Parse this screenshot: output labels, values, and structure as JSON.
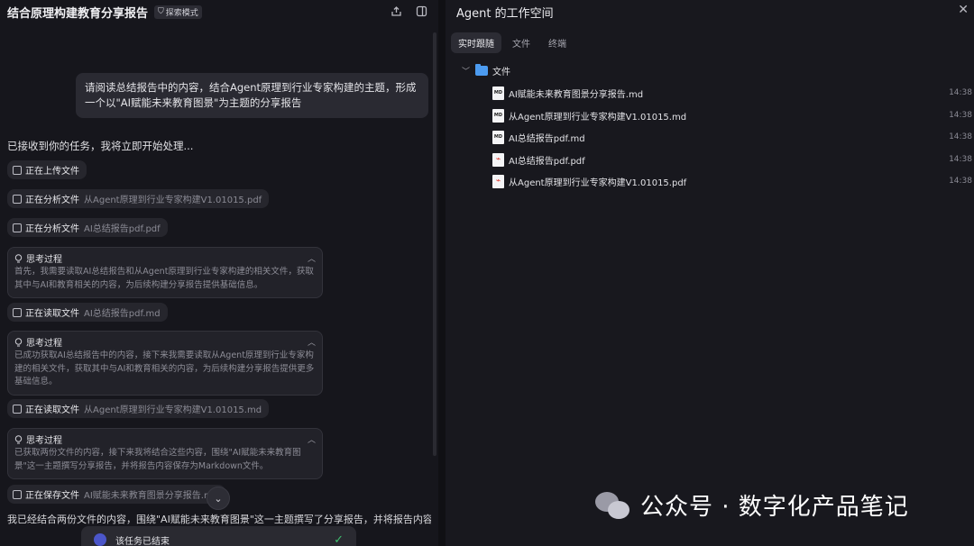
{
  "left": {
    "title": "结合原理构建教育分享报告",
    "mode_badge": "探索模式",
    "user_message": "请阅读总结报告中的内容，结合Agent原理到行业专家构建的主题，形成一个以\"AI赋能未来教育图景\"为主题的分享报告",
    "ack": "已接收到你的任务，我将立即开始处理...",
    "steps": [
      {
        "label": "正在上传文件",
        "file": ""
      },
      {
        "label": "正在分析文件",
        "file": "从Agent原理到行业专家构建V1.01015.pdf"
      },
      {
        "label": "正在分析文件",
        "file": "AI总结报告pdf.pdf"
      },
      {
        "label": "正在读取文件",
        "file": "AI总结报告pdf.md"
      },
      {
        "label": "正在读取文件",
        "file": "从Agent原理到行业专家构建V1.01015.md"
      },
      {
        "label": "正在保存文件",
        "file": "AI赋能未来教育图景分享报告.md"
      }
    ],
    "thinking": [
      {
        "title": "思考过程",
        "body": "首先，我需要读取AI总结报告和从Agent原理到行业专家构建的相关文件，获取其中与AI和教育相关的内容，为后续构建分享报告提供基础信息。"
      },
      {
        "title": "思考过程",
        "body": "已成功获取AI总结报告中的内容，接下来我需要读取从Agent原理到行业专家构建的相关文件，获取其中与AI和教育相关的内容，为后续构建分享报告提供更多基础信息。"
      },
      {
        "title": "思考过程",
        "body": "已获取两份文件的内容，接下来我将结合这些内容，围绕\"AI赋能未来教育图景\"这一主题撰写分享报告，并将报告内容保存为Markdown文件。"
      }
    ],
    "summary": "我已经结合两份文件的内容，围绕\"AI赋能未来教育图景\"这一主题撰写了分享报告，并将报告内容",
    "done_text": "该任务已结束"
  },
  "right": {
    "title": "Agent 的工作空间",
    "tabs": [
      "实时跟随",
      "文件",
      "终端"
    ],
    "folder": "文件",
    "files": [
      {
        "name": "AI赋能未来教育图景分享报告.md",
        "type": "md",
        "time": "14:38"
      },
      {
        "name": "从Agent原理到行业专家构建V1.01015.md",
        "type": "md",
        "time": "14:38"
      },
      {
        "name": "AI总结报告pdf.md",
        "type": "md",
        "time": "14:38"
      },
      {
        "name": "AI总结报告pdf.pdf",
        "type": "pdf",
        "time": "14:38"
      },
      {
        "name": "从Agent原理到行业专家构建V1.01015.pdf",
        "type": "pdf",
        "time": "14:38"
      }
    ]
  },
  "watermark": {
    "text": "公众号 · 数字化产品笔记"
  }
}
